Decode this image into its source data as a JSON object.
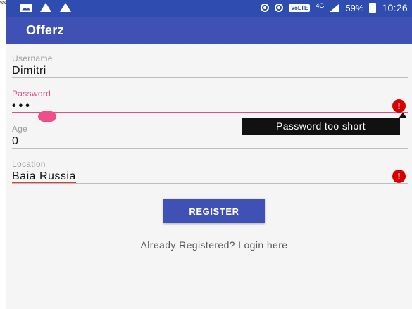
{
  "status_bar": {
    "network_type": "4G",
    "volte": "VoLTE",
    "battery": "59%",
    "time": "10:26",
    "icons": [
      "image-icon",
      "warning-icon",
      "warning-icon",
      "hotspot-icon",
      "wifi-calling-icon",
      "signal-icon",
      "battery-icon"
    ]
  },
  "app_bar": {
    "title": "Offerz"
  },
  "form": {
    "username": {
      "label": "Username",
      "value": "Dimitri"
    },
    "password": {
      "label": "Password",
      "value": "•••",
      "error": "Password too short"
    },
    "age": {
      "label": "Age",
      "value": "0"
    },
    "location": {
      "label": "Location",
      "value": "Baia Russia"
    },
    "error_icon_glyph": "!"
  },
  "register_button": {
    "label": "REGISTER"
  },
  "login_link": {
    "label": "Already Registered? Login here"
  },
  "colors": {
    "primary": "#3f51b5",
    "primary_dark": "#2f4cb0",
    "accent": "#e24f82",
    "error": "#d50000"
  },
  "corner_glyph": "ss"
}
